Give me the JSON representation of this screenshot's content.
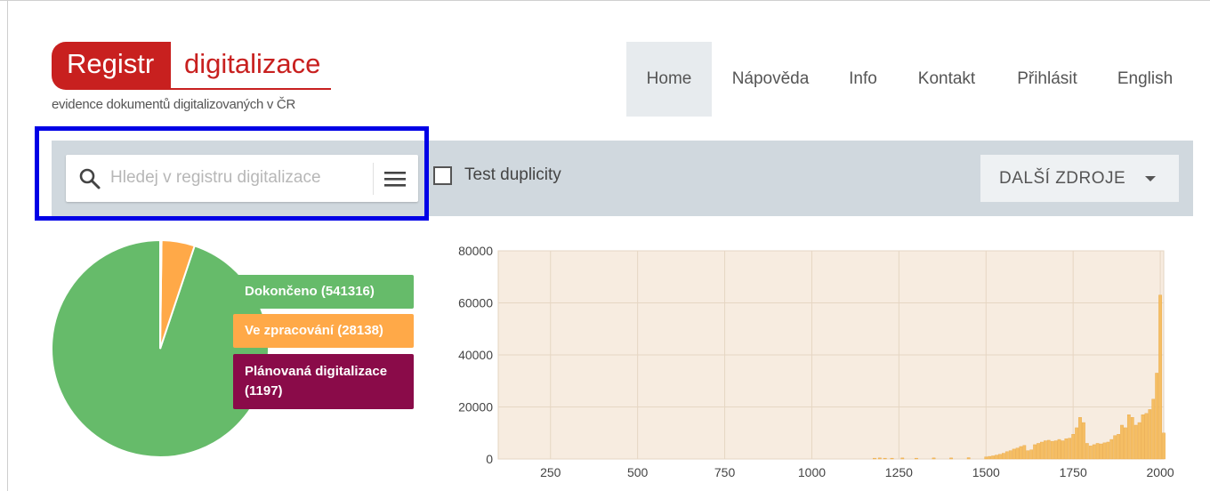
{
  "logo": {
    "left": "Registr",
    "right": "digitalizace",
    "subtitle": "evidence dokumentů digitalizovaných v ČR",
    "color": "#c8201f"
  },
  "nav": {
    "items": [
      "Home",
      "Nápověda",
      "Info",
      "Kontakt",
      "Přihlásit",
      "English"
    ],
    "active": "Home"
  },
  "toolbar": {
    "search_placeholder": "Hledej v registru digitalizace",
    "search_value": "",
    "search_icon": "search-icon",
    "menu_icon": "hamburger-menu-icon",
    "checkbox_label": "Test duplicity",
    "checkbox_checked": false,
    "more_label": "DALŠÍ ZDROJE",
    "more_icon": "caret-down-icon"
  },
  "chart_data": [
    {
      "type": "pie",
      "labels": [
        "Dokončeno (541316)",
        "Ve zpracování (28138)",
        "Plánovaná digitalizace (1197)"
      ],
      "values": [
        541316,
        28138,
        1197
      ],
      "colors": [
        "#66bb6a",
        "#ffa948",
        "#8a0b49"
      ],
      "legend": "right"
    },
    {
      "type": "bar",
      "ylim": [
        0,
        80000
      ],
      "yticks": [
        0,
        20000,
        40000,
        60000,
        80000
      ],
      "xlim": [
        100,
        2010
      ],
      "xticks": [
        250,
        500,
        750,
        1000,
        1250,
        1500,
        1750,
        2000
      ],
      "grid": true,
      "background": "#f7ece0",
      "bar_color": "#f5be64",
      "x": [
        1180,
        1195,
        1210,
        1230,
        1260,
        1300,
        1350,
        1400,
        1450,
        1500,
        1510,
        1520,
        1530,
        1540,
        1550,
        1560,
        1570,
        1580,
        1590,
        1600,
        1610,
        1620,
        1630,
        1640,
        1650,
        1660,
        1670,
        1680,
        1690,
        1700,
        1710,
        1720,
        1730,
        1740,
        1750,
        1760,
        1770,
        1780,
        1790,
        1800,
        1810,
        1820,
        1830,
        1840,
        1850,
        1860,
        1870,
        1880,
        1890,
        1900,
        1910,
        1920,
        1930,
        1940,
        1950,
        1960,
        1970,
        1980,
        1990,
        2000,
        2010
      ],
      "values": [
        300,
        400,
        300,
        300,
        400,
        300,
        400,
        400,
        500,
        800,
        1000,
        1200,
        1500,
        1800,
        2200,
        2800,
        3200,
        3800,
        4200,
        4800,
        5200,
        3200,
        3500,
        5500,
        6000,
        6500,
        7000,
        7200,
        6800,
        7000,
        7500,
        7000,
        7800,
        8000,
        9500,
        12000,
        16000,
        14000,
        6000,
        5000,
        5500,
        6000,
        5800,
        6200,
        6500,
        7500,
        9000,
        9500,
        13000,
        12000,
        17000,
        16000,
        13000,
        14000,
        17000,
        17500,
        19000,
        23000,
        33000,
        63000,
        10000
      ]
    }
  ]
}
